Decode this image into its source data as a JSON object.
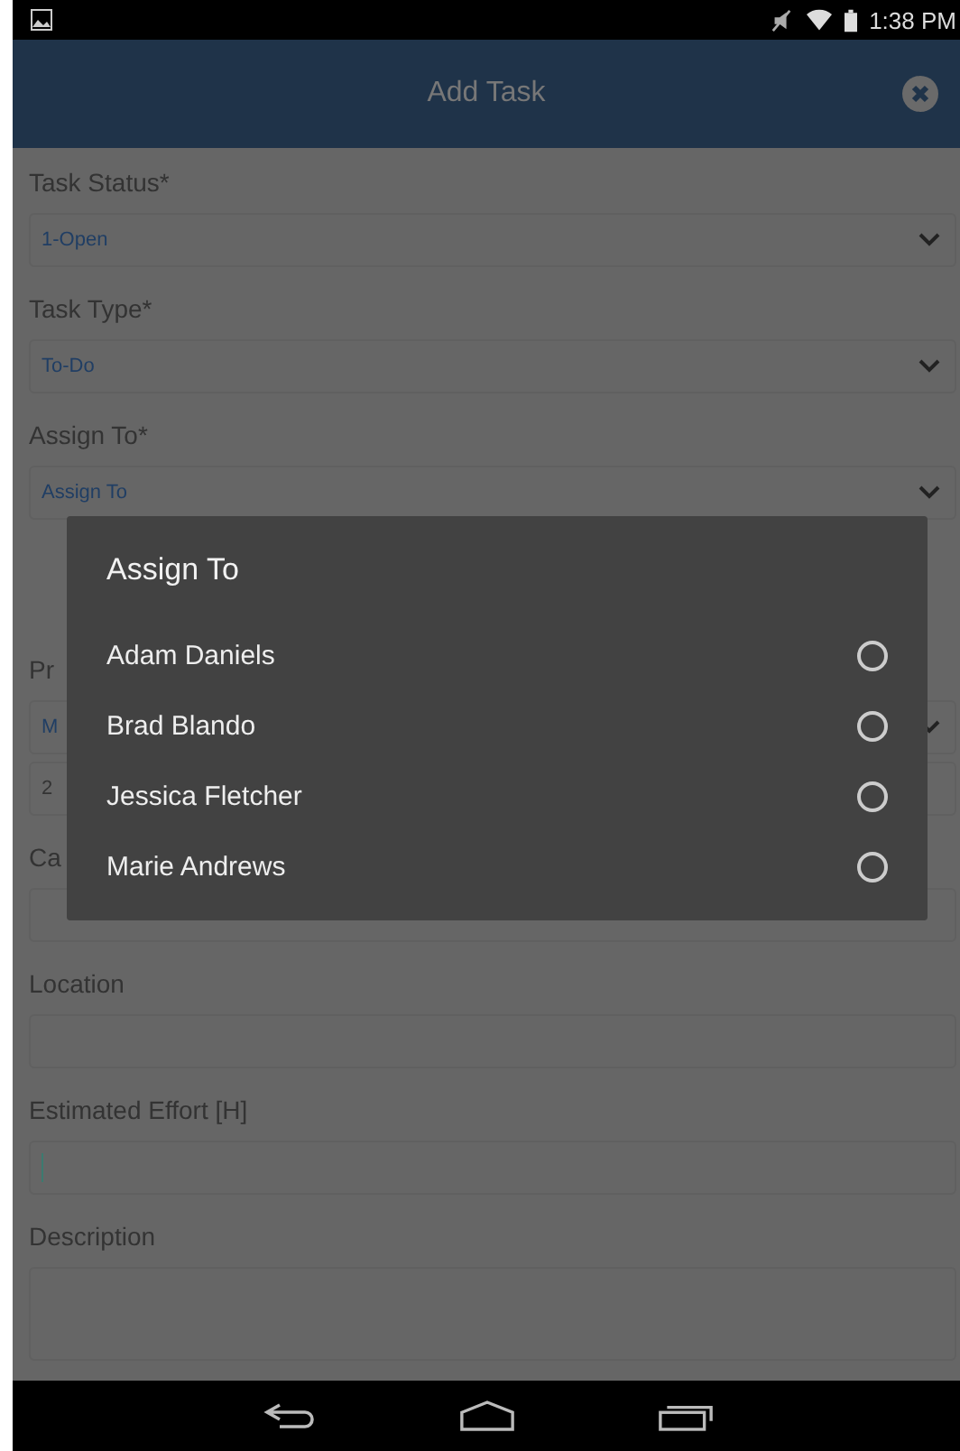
{
  "status_bar": {
    "time": "1:38 PM"
  },
  "header": {
    "title": "Add Task"
  },
  "form": [
    {
      "label": "Task Status*",
      "kind": "select",
      "value": "1-Open"
    },
    {
      "label": "Task Type*",
      "kind": "select",
      "value": "To-Do"
    },
    {
      "label": "Assign To*",
      "kind": "select",
      "value": "Assign To"
    },
    {
      "kind": "hidden"
    },
    {
      "label": "Pr",
      "kind": "select",
      "value": "M"
    },
    {
      "kind": "text",
      "value": "2"
    },
    {
      "label": "Ca",
      "kind": "text"
    },
    {
      "label": "Location",
      "kind": "text"
    },
    {
      "label": "Estimated Effort [H]",
      "kind": "text",
      "cursor": true
    },
    {
      "label": "Description",
      "kind": "area"
    }
  ],
  "dialog": {
    "title": "Assign To",
    "options": [
      {
        "label": "Adam Daniels",
        "selected": false
      },
      {
        "label": "Brad Blando",
        "selected": false
      },
      {
        "label": "Jessica Fletcher",
        "selected": false
      },
      {
        "label": "Marie Andrews",
        "selected": false
      }
    ]
  }
}
